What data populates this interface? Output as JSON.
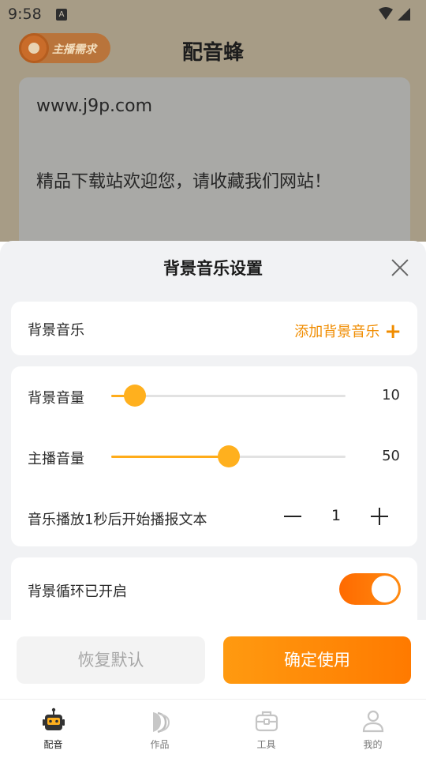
{
  "status_bar": {
    "time": "9:58",
    "notification_letter": "A"
  },
  "app": {
    "title": "配音蜂",
    "anchor_badge_label": "主播需求",
    "text_content": {
      "line1": "www.j9p.com",
      "line2": "精品下载站欢迎您，请收藏我们网站！"
    }
  },
  "sheet": {
    "title": "背景音乐设置",
    "background_music": {
      "label": "背景音乐",
      "add_label": "添加背景音乐"
    },
    "bg_volume": {
      "label": "背景音量",
      "value": 10
    },
    "anchor_volume": {
      "label": "主播音量",
      "value": 50
    },
    "delay": {
      "label": "音乐播放1秒后开始播报文本",
      "value": "1"
    },
    "loop": {
      "label": "背景循环已开启",
      "enabled": true
    }
  },
  "actions": {
    "reset_label": "恢复默认",
    "confirm_label": "确定使用"
  },
  "nav": {
    "items": [
      {
        "label": "配音",
        "icon": "robot-icon",
        "active": true
      },
      {
        "label": "作品",
        "icon": "works-icon",
        "active": false
      },
      {
        "label": "工具",
        "icon": "toolbox-icon",
        "active": false
      },
      {
        "label": "我的",
        "icon": "profile-icon",
        "active": false
      }
    ]
  },
  "colors": {
    "accent": "#ff8a00",
    "slider": "#ffac1a",
    "dim_overlay": "#a79c86"
  }
}
